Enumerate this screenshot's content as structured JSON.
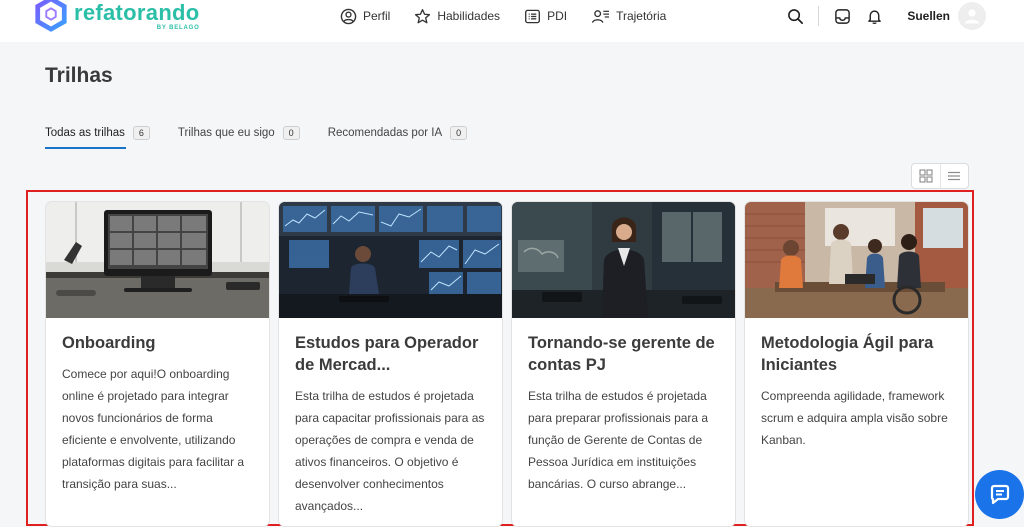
{
  "brand": {
    "name": "refatorando",
    "tagline": "BY BELAGO",
    "color": "#2bbfa8"
  },
  "nav": {
    "items": [
      {
        "label": "Perfil",
        "icon": "user-circle-icon"
      },
      {
        "label": "Habilidades",
        "icon": "star-icon"
      },
      {
        "label": "PDI",
        "icon": "list-box-icon"
      },
      {
        "label": "Trajetória",
        "icon": "user-list-icon"
      }
    ]
  },
  "user": {
    "name": "Suellen"
  },
  "page": {
    "title": "Trilhas"
  },
  "tabs": [
    {
      "label": "Todas as trilhas",
      "count": "6",
      "active": true
    },
    {
      "label": "Trilhas que eu sigo",
      "count": "0",
      "active": false
    },
    {
      "label": "Recomendadas por IA",
      "count": "0",
      "active": false
    }
  ],
  "cards": [
    {
      "title": "Onboarding",
      "description": "Comece por aqui!O onboarding online é projetado para integrar novos funcionários de forma eficiente e envolvente, utilizando plataformas digitais para facilitar a transição para suas...",
      "image": "video-conference-office"
    },
    {
      "title": "Estudos para Operador de Mercad...",
      "description": "Esta trilha de estudos é projetada para capacitar profissionais para as operações de compra e venda de ativos financeiros. O objetivo é desenvolver conhecimentos avançados...",
      "image": "trading-desk-monitors"
    },
    {
      "title": "Tornando-se gerente de contas PJ",
      "description": "Esta trilha de estudos é projetada para preparar profissionais para a função de Gerente de Contas de Pessoa Jurídica em instituições bancárias. O curso abrange...",
      "image": "businesswoman-office"
    },
    {
      "title": "Metodologia Ágil para Iniciantes",
      "description": "Compreenda agilidade, framework scrum e adquira ampla visão sobre Kanban.",
      "image": "team-meeting"
    }
  ],
  "colors": {
    "accent": "#1a73c9",
    "highlight": "#e02020",
    "fab": "#1a73e8"
  }
}
